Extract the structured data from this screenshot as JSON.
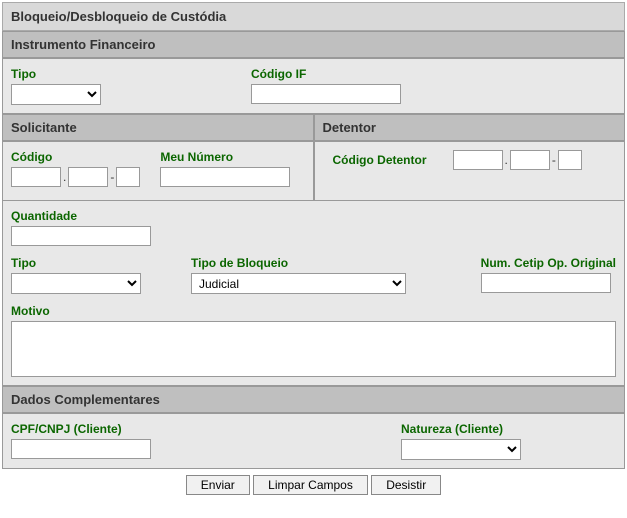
{
  "page_title": "Bloqueio/Desbloqueio de Custódia",
  "instrumento": {
    "header": "Instrumento Financeiro",
    "tipo_label": "Tipo",
    "tipo_value": "",
    "codigo_if_label": "Código IF",
    "codigo_if_value": ""
  },
  "solicitante": {
    "header": "Solicitante",
    "codigo_label": "Código",
    "codigo_p1": "",
    "codigo_p2": "",
    "codigo_p3": "",
    "meu_numero_label": "Meu Número",
    "meu_numero_value": ""
  },
  "detentor": {
    "header": "Detentor",
    "codigo_label": "Código Detentor",
    "codigo_p1": "",
    "codigo_p2": "",
    "codigo_p3": ""
  },
  "mid": {
    "quantidade_label": "Quantidade",
    "quantidade_value": "",
    "tipo_label": "Tipo",
    "tipo_value": "",
    "tipo_bloqueio_label": "Tipo de Bloqueio",
    "tipo_bloqueio_value": "Judicial",
    "num_cetip_label": "Num. Cetip Op. Original",
    "num_cetip_value": "",
    "motivo_label": "Motivo",
    "motivo_value": ""
  },
  "complementares": {
    "header": "Dados Complementares",
    "cpf_label": "CPF/CNPJ (Cliente)",
    "cpf_value": "",
    "natureza_label": "Natureza (Cliente)",
    "natureza_value": ""
  },
  "buttons": {
    "enviar": "Enviar",
    "limpar": "Limpar Campos",
    "desistir": "Desistir"
  }
}
